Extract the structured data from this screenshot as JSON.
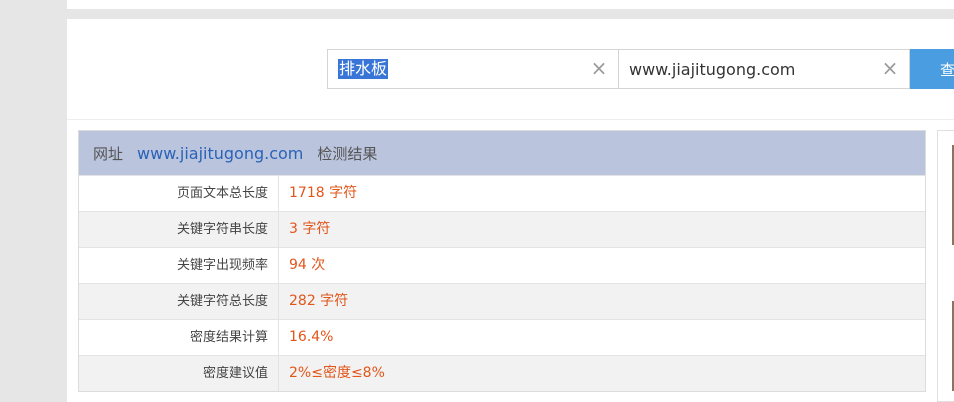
{
  "search": {
    "keyword_value": "排水板",
    "url_value": "www.jiajitugong.com",
    "query_label": "查"
  },
  "result": {
    "header_prefix": "网址",
    "header_url": "www.jiajitugong.com",
    "header_suffix": "检测结果",
    "rows": [
      {
        "label": "页面文本总长度",
        "value": "1718 字符"
      },
      {
        "label": "关键字符串长度",
        "value": "3 字符"
      },
      {
        "label": "关键字出现频率",
        "value": "94 次"
      },
      {
        "label": "关键字符总长度",
        "value": "282 字符"
      },
      {
        "label": "密度结果计算",
        "value": "16.4%"
      },
      {
        "label": "密度建议值",
        "value": "2%≤密度≤8%"
      }
    ]
  },
  "icons": {
    "clear": "close-icon"
  },
  "colors": {
    "accent_button": "#4a9de1",
    "header_bg": "#bac4dd",
    "value_text": "#e2561a",
    "link": "#2a62b8"
  }
}
